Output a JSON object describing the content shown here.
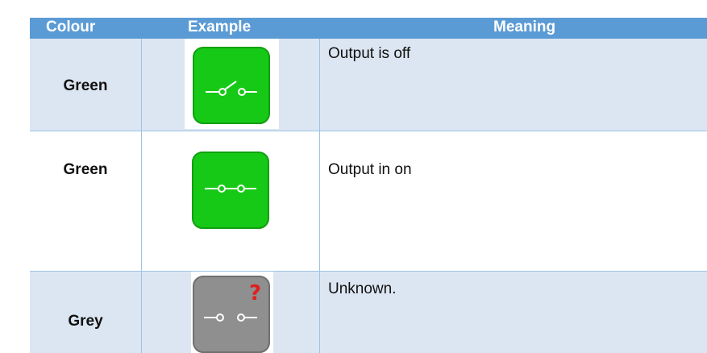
{
  "header": {
    "colour": "Colour",
    "example": "Example",
    "meaning": "Meaning"
  },
  "rows": [
    {
      "colour": "Green",
      "meaning": "Output is off",
      "icon": "switch-open-icon",
      "icon_color": "#17c917"
    },
    {
      "colour": "Green",
      "meaning": "Output in on",
      "icon": "switch-closed-icon",
      "icon_color": "#17c917"
    },
    {
      "colour": "Grey",
      "meaning": "Unknown.",
      "icon": "switch-unknown-icon",
      "icon_color": "#8f8f8f"
    }
  ],
  "colors": {
    "header_bg": "#5b9bd5",
    "row_shaded": "#dce6f2",
    "question_mark": "#e02020"
  }
}
